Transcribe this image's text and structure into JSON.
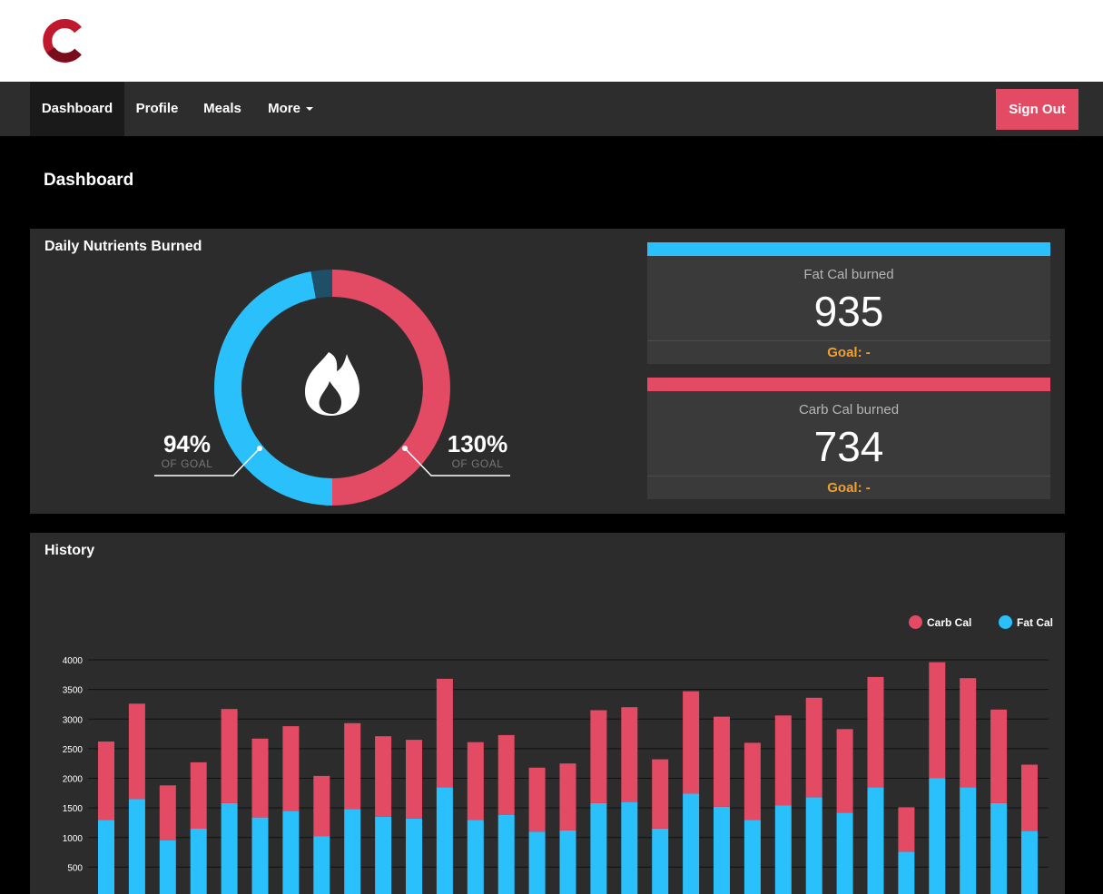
{
  "app": {
    "logo_letter": "C"
  },
  "nav": {
    "items": [
      {
        "label": "Dashboard",
        "active": true
      },
      {
        "label": "Profile",
        "active": false
      },
      {
        "label": "Meals",
        "active": false
      },
      {
        "label": "More",
        "active": false,
        "dropdown": true
      }
    ],
    "signout_label": "Sign Out"
  },
  "page": {
    "title": "Dashboard"
  },
  "nutrients": {
    "title": "Daily Nutrients Burned",
    "icon": "flame-icon",
    "fat": {
      "percent_label": "94%",
      "percent_value": 94,
      "of_goal_label": "OF GOAL"
    },
    "carb": {
      "percent_label": "130%",
      "percent_value": 130,
      "of_goal_label": "OF GOAL"
    },
    "cards": [
      {
        "label": "Fat Cal burned",
        "value": "935",
        "goal": "Goal: -",
        "color": "#29c0fb"
      },
      {
        "label": "Carb Cal burned",
        "value": "734",
        "goal": "Goal: -",
        "color": "#e34a64"
      }
    ]
  },
  "history": {
    "title": "History",
    "legend": [
      {
        "label": "Carb Cal",
        "color": "#e34a64"
      },
      {
        "label": "Fat Cal",
        "color": "#29c0fb"
      }
    ]
  },
  "chart_data": {
    "type": "bar",
    "stacked": true,
    "ylim": [
      0,
      4000
    ],
    "yticks": [
      500,
      1000,
      1500,
      2000,
      2500,
      3000,
      3500,
      4000
    ],
    "series": [
      {
        "name": "Fat Cal",
        "color": "#29c0fb",
        "values": [
          1300,
          1650,
          950,
          1150,
          1580,
          1340,
          1450,
          1020,
          1480,
          1350,
          1320,
          1850,
          1300,
          1380,
          1100,
          1120,
          1580,
          1600,
          1150,
          1740,
          1520,
          1300,
          1540,
          1680,
          1420,
          1850,
          760,
          2000,
          1850,
          1580,
          1110
        ]
      },
      {
        "name": "Carb Cal",
        "color": "#e34a64",
        "values": [
          1320,
          1610,
          930,
          1120,
          1590,
          1330,
          1430,
          1020,
          1450,
          1360,
          1330,
          1830,
          1310,
          1350,
          1080,
          1130,
          1570,
          1600,
          1170,
          1730,
          1520,
          1300,
          1520,
          1680,
          1410,
          1860,
          750,
          1960,
          1840,
          1580,
          1120
        ]
      }
    ]
  },
  "colors": {
    "accent": "#e34a64",
    "fat": "#29c0fb",
    "carb": "#e34a64",
    "goal": "#f0a030"
  }
}
